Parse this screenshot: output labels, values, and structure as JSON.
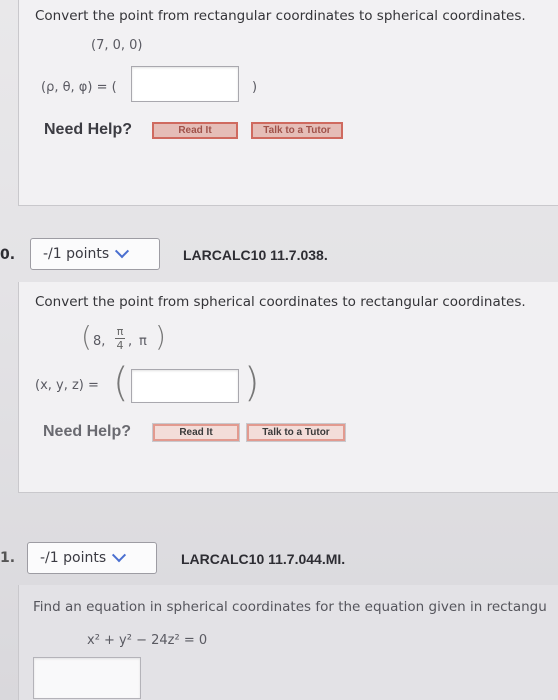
{
  "q9": {
    "instruction": "Convert the point from rectangular coordinates to spherical coordinates.",
    "point": "(7, 0, 0)",
    "answer_label": "(ρ, θ, φ) = (",
    "answer_close": ")",
    "answer_value": "",
    "need_help": "Need Help?",
    "read_it": "Read It",
    "talk_tutor": "Talk to a Tutor"
  },
  "q10": {
    "number": "0.",
    "points": "-/1 points",
    "ref": "LARCALC10 11.7.038.",
    "instruction": "Convert the point from spherical coordinates to rectangular coordinates.",
    "point_open": "(",
    "point_first": "8,",
    "frac_num": "π",
    "frac_den": "4",
    "point_comma": ",",
    "point_last": "π",
    "point_close": ")",
    "answer_label": "(x, y, z) =",
    "answer_open": "(",
    "answer_close": ")",
    "answer_value": "",
    "need_help": "Need Help?",
    "read_it": "Read It",
    "talk_tutor": "Talk to a Tutor"
  },
  "q11": {
    "number": "1.",
    "points": "-/1 points",
    "ref": "LARCALC10 11.7.044.MI.",
    "instruction": "Find an equation in spherical coordinates for the equation given in rectangu",
    "equation": "x² + y² − 24z² = 0"
  },
  "colors": {
    "button_fill": "#f3ddd9",
    "button_border": "#e29a8f",
    "chevron": "#4a6fd0"
  }
}
